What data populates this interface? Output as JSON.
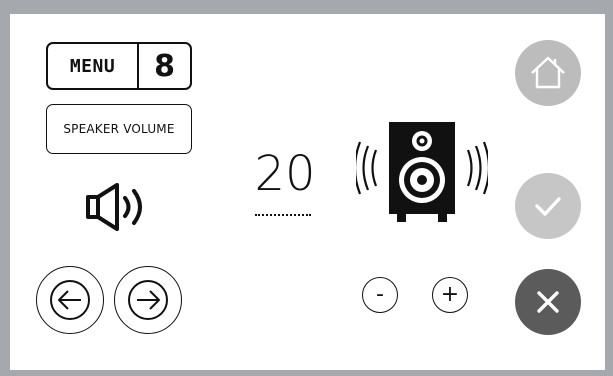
{
  "menu": {
    "label": "MENU",
    "number": "8"
  },
  "screen": {
    "title": "SPEAKER VOLUME"
  },
  "volume": {
    "value": "20"
  },
  "stepper": {
    "decrease_label": "-",
    "increase_label": "+"
  },
  "icons": {
    "speaker_small": "speaker-volume-icon",
    "speaker_big": "loudspeaker-icon",
    "back": "arrow-left-icon",
    "forward": "arrow-right-icon",
    "home": "home-icon",
    "confirm": "check-icon",
    "cancel": "close-icon"
  },
  "colors": {
    "frame": "#a5a8ad",
    "home_button": "#bcbcbc",
    "confirm_button": "#c6c6c6",
    "cancel_button": "#5b5b5b",
    "text": "#111111"
  }
}
